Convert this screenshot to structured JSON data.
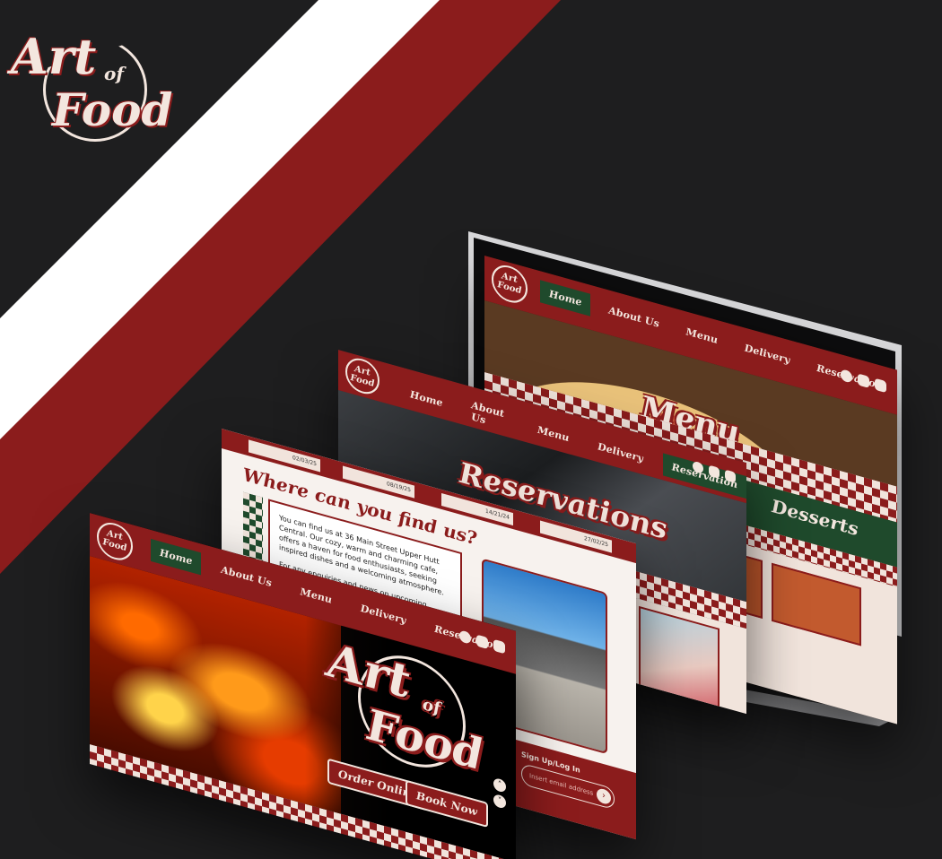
{
  "brand": {
    "art": "Art",
    "of": "of",
    "food": "Food"
  },
  "nav": {
    "home": "Home",
    "about": "About Us",
    "menu": "Menu",
    "delivery": "Delivery",
    "reservation": "Reservation"
  },
  "menu_screen": {
    "title": "Menu",
    "section": "Desserts"
  },
  "reservation_screen": {
    "title": "Reservations",
    "dates": [
      "02/03/25",
      "08/19/25",
      "14/21/24",
      "27/02/25"
    ]
  },
  "find_screen": {
    "heading": "Where can you find us?",
    "para1": "You can find us at 36 Main Street Upper Hutt Central. Our cozy, warm and charming cafe, offers a haven for food enthusiasts, seeking inspired dishes and a welcoming atmosphere.",
    "para2": "For any enquiries and news on upcoming events,",
    "signup_label": "Sign Up/Log In",
    "email_placeholder": "Insert email address"
  },
  "home_screen": {
    "order_btn": "Order Online",
    "book_btn": "Book Now"
  },
  "colors": {
    "brand_red": "#8b1c1c",
    "cream": "#f3e6de",
    "green": "#1f4a2c",
    "background": "#1e1e1f"
  }
}
